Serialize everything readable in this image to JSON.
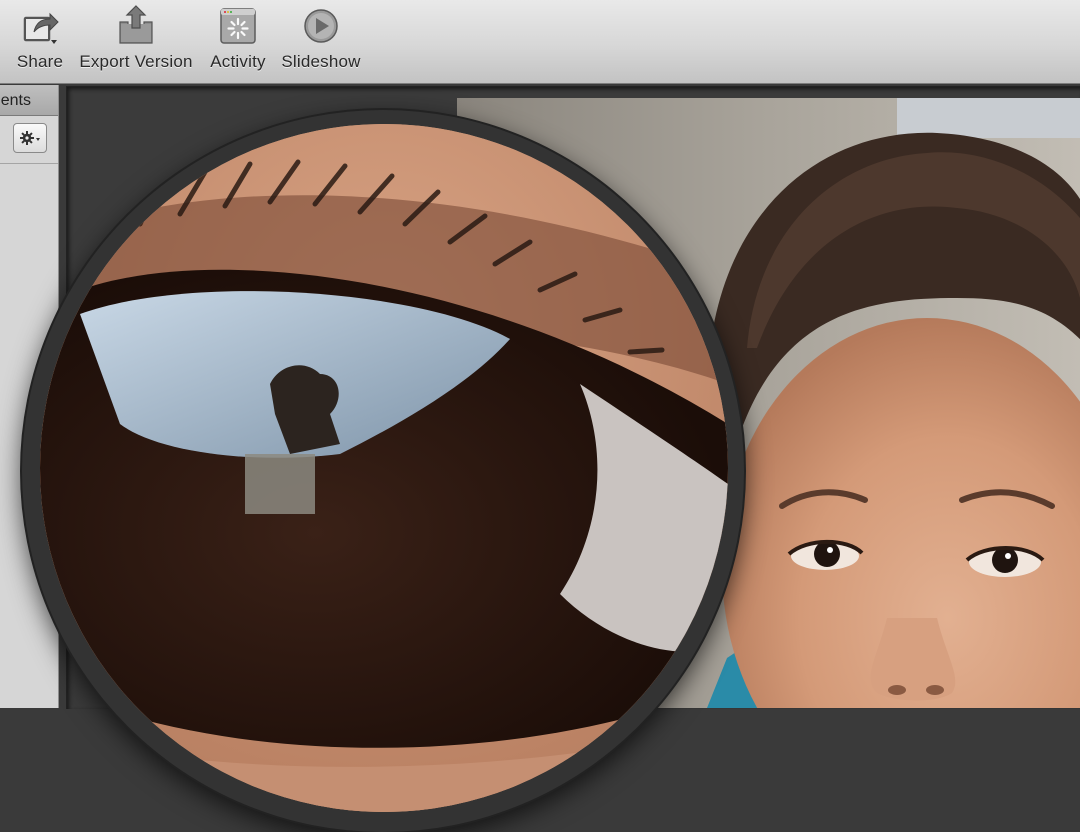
{
  "toolbar": {
    "items": [
      {
        "label": "Share",
        "icon": "share-icon"
      },
      {
        "label": "Export Version",
        "icon": "export-icon"
      },
      {
        "label": "Activity",
        "icon": "activity-icon"
      },
      {
        "label": "Slideshow",
        "icon": "slideshow-icon"
      }
    ]
  },
  "panel": {
    "tab_label": "ents",
    "action_icon": "gear-icon"
  },
  "viewer": {
    "photo_subject": "child-portrait",
    "loupe_subject": "eye-closeup"
  },
  "colors": {
    "toolbar_top": "#e9e9e9",
    "toolbar_bottom": "#c3c3c3",
    "viewer_bg": "#3b3b3b",
    "panel_bg": "#d6d6d6"
  }
}
